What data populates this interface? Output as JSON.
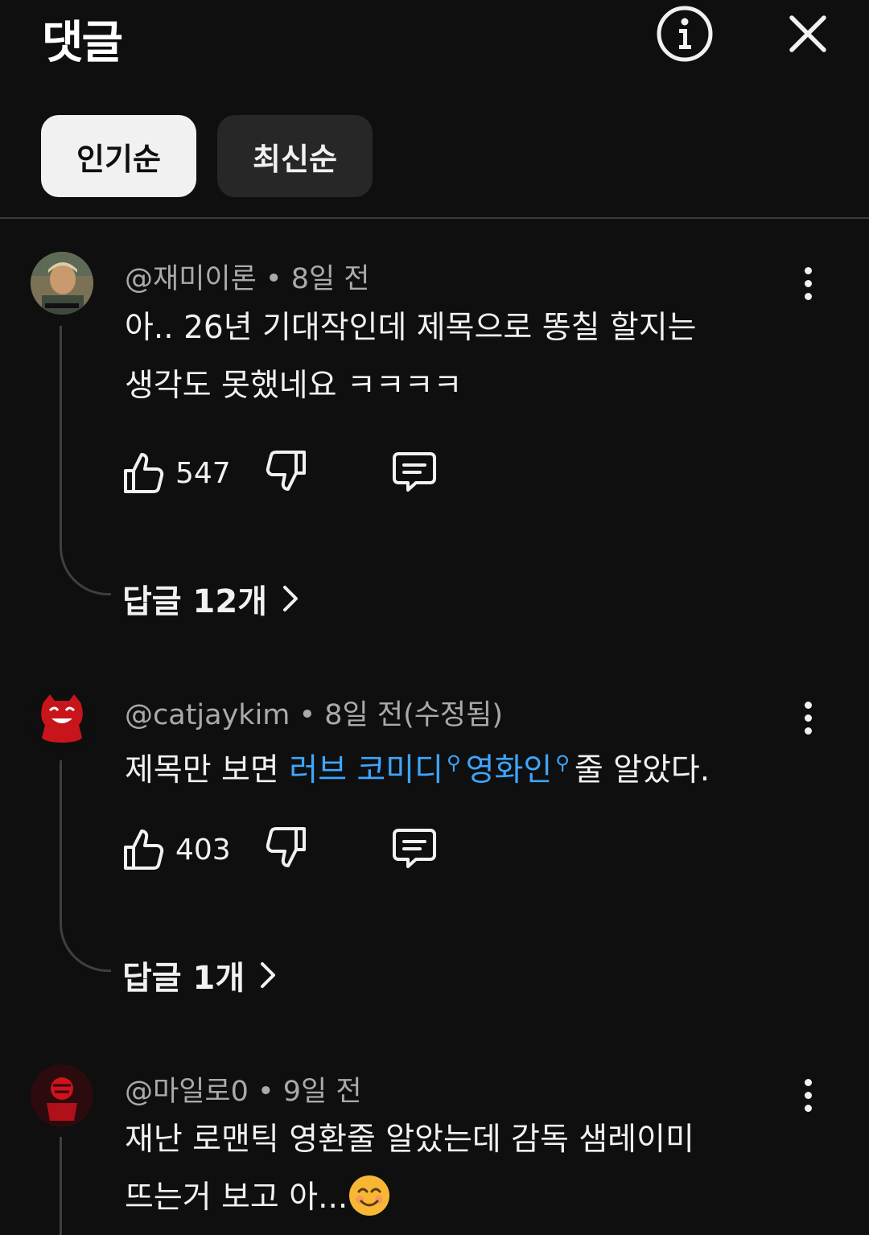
{
  "header": {
    "title": "댓글",
    "info_icon": "info-circle-icon",
    "close_icon": "close-icon"
  },
  "sort": {
    "popular_label": "인기순",
    "newest_label": "최신순",
    "selected": "인기순"
  },
  "colors": {
    "background": "#0f0f0f",
    "link": "#3ea6ff",
    "secondary_text": "#aaaaaa",
    "chip_active": "#f1f1f1",
    "chip_inactive": "#272727"
  },
  "comments": [
    {
      "author": "@재미이론",
      "time": "8일 전",
      "meta": "@재미이론 • 8일 전",
      "text_line1": "아.. 26년 기대작인데 제목으로 똥칠 할지는",
      "text_line2": "생각도 못했네요 ㅋㅋㅋㅋ",
      "likes": "547",
      "replies_label": "답글 12개"
    },
    {
      "author": "@catjaykim",
      "time": "8일 전(수정됨)",
      "meta": "@catjaykim • 8일 전(수정됨)",
      "text_prefix": "제목만 보면 ",
      "link1": "러브 코미디",
      "link2": "영화인",
      "text_suffix": "줄 알았다.",
      "likes": "403",
      "replies_label": "답글 1개"
    },
    {
      "author": "@마일로0",
      "time": "9일 전",
      "meta": "@마일로0 • 9일 전",
      "text_line1": "재난 로맨틱 영환줄 알았는데 감독 샘레이미",
      "text_line2": "뜨는거 보고 아..."
    }
  ]
}
